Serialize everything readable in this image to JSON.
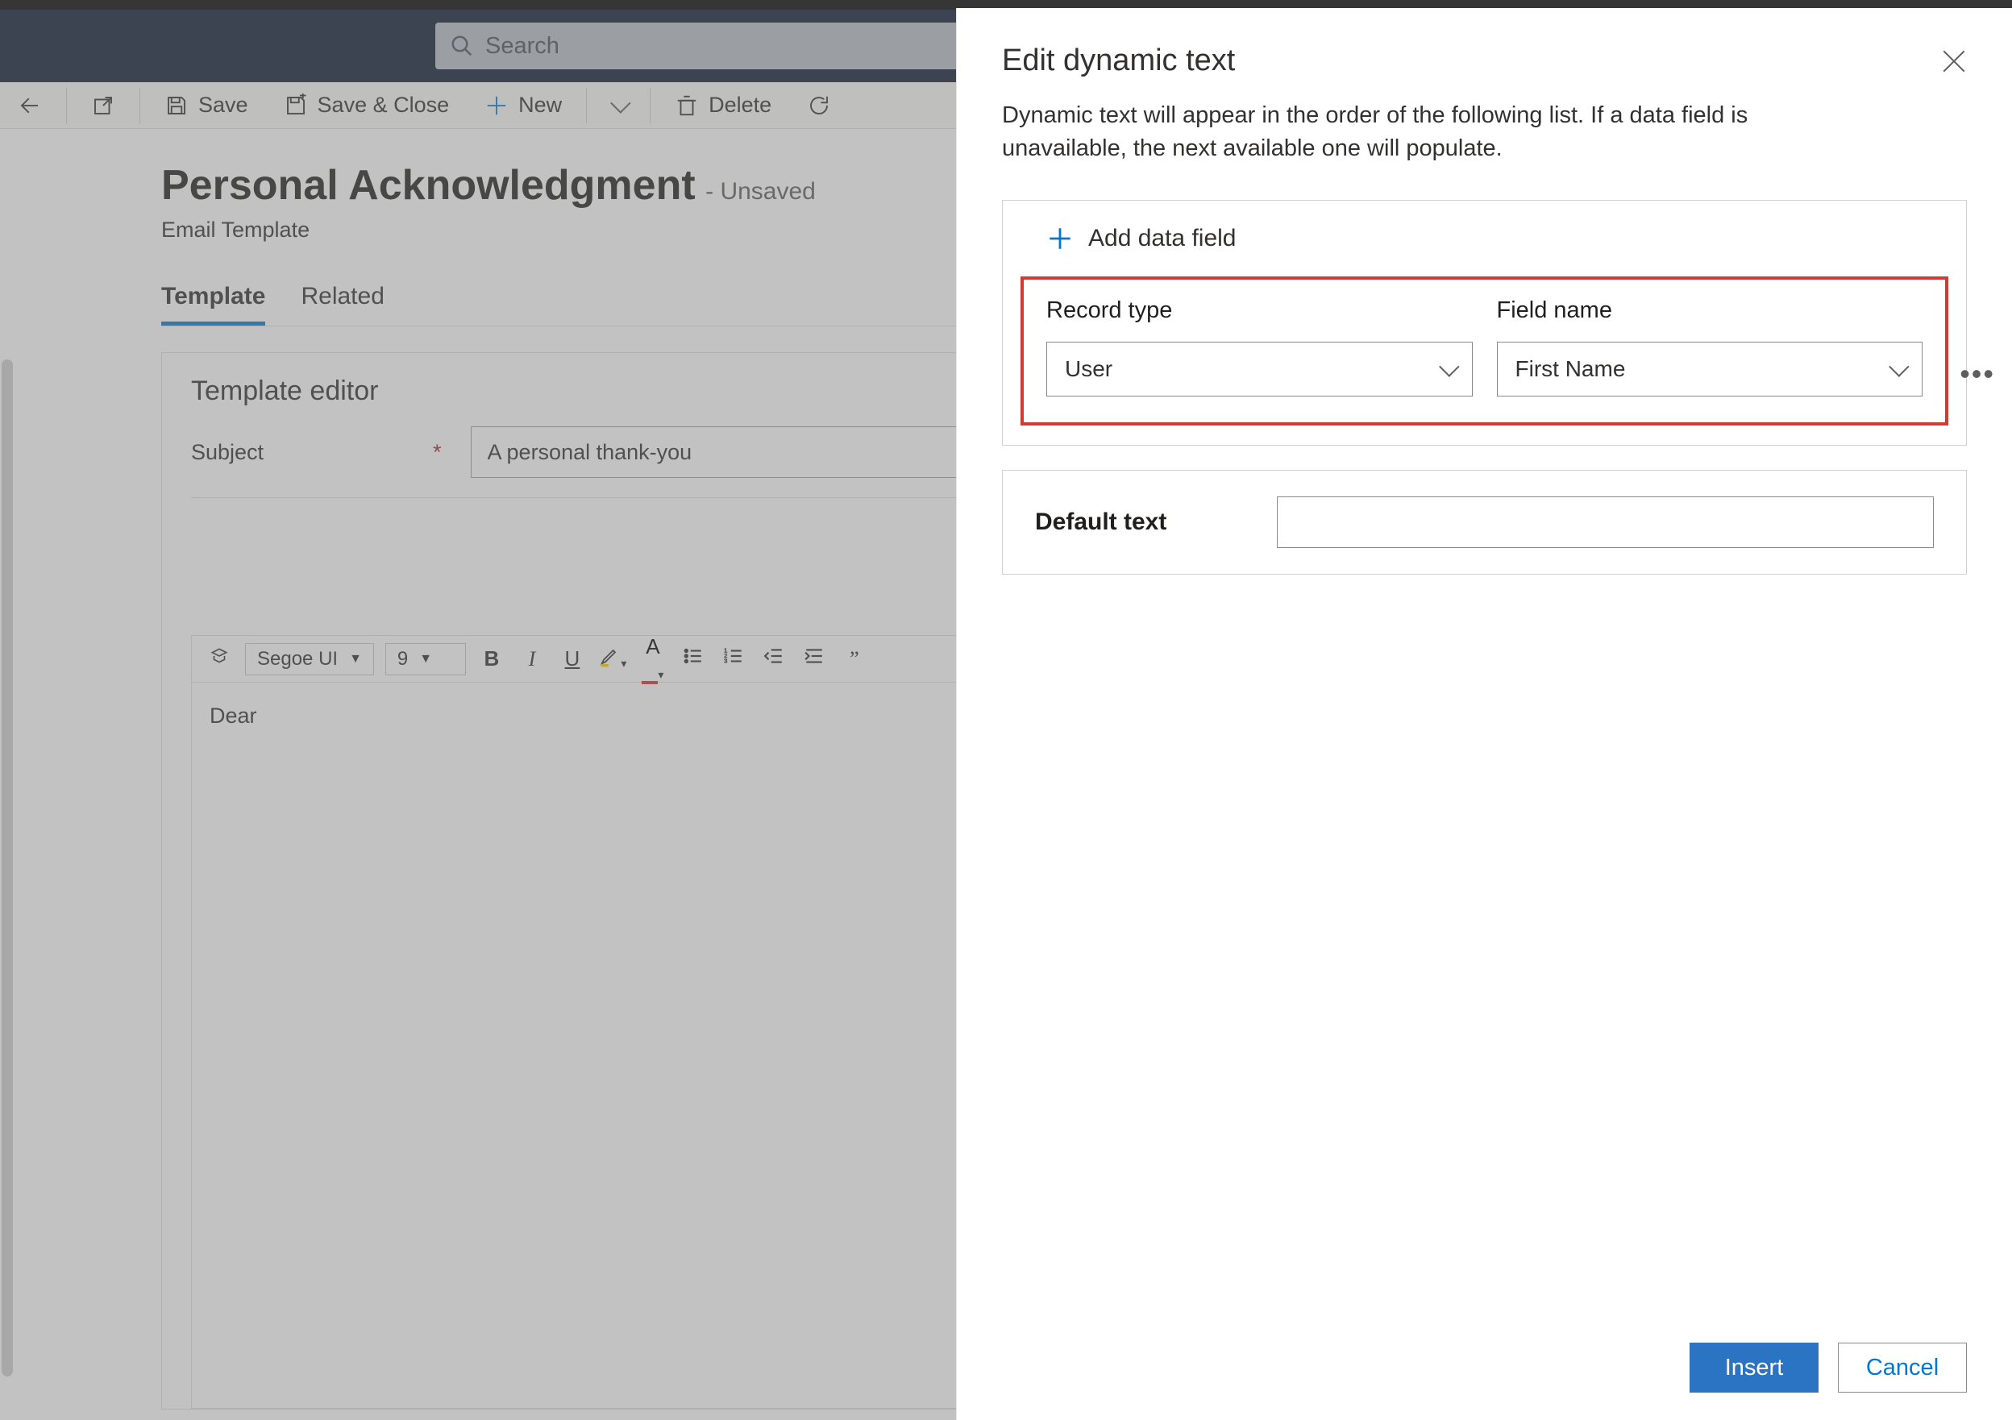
{
  "search": {
    "placeholder": "Search"
  },
  "commands": {
    "save": "Save",
    "save_close": "Save & Close",
    "new": "New",
    "delete": "Delete"
  },
  "page": {
    "title": "Personal Acknowledgment",
    "status": "- Unsaved",
    "subtitle": "Email Template"
  },
  "tabs": {
    "template": "Template",
    "related": "Related"
  },
  "editor": {
    "section_title": "Template editor",
    "subject_label": "Subject",
    "subject_value": "A personal thank-you",
    "font_family": "Segoe UI",
    "font_size": "9",
    "body": "Dear"
  },
  "panel": {
    "title": "Edit dynamic text",
    "description": "Dynamic text will appear in the order of the following list. If a data field is unavailable, the next available one will populate.",
    "add_field": "Add data field",
    "record_type_label": "Record type",
    "record_type_value": "User",
    "field_name_label": "Field name",
    "field_name_value": "First Name",
    "default_text_label": "Default text",
    "default_text_value": "",
    "insert": "Insert",
    "cancel": "Cancel"
  }
}
